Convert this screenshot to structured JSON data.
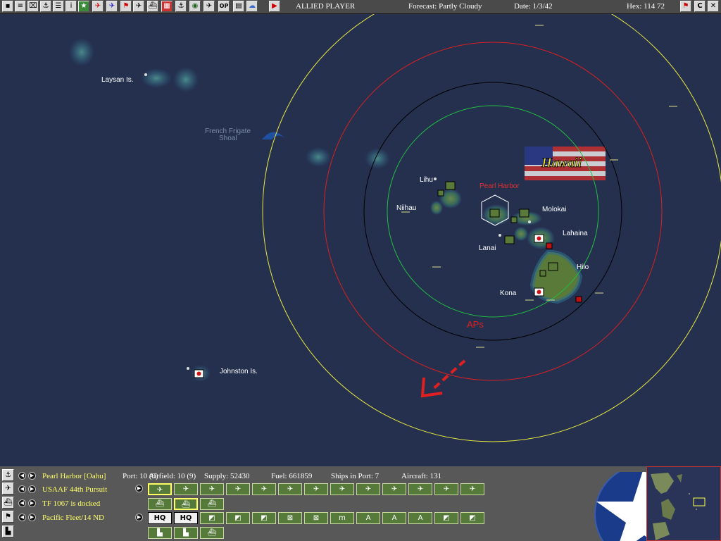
{
  "topbar": {
    "tool_icons": [
      "save-icon",
      "document-icon",
      "report-icon",
      "ship-icon",
      "info-icon",
      "star-icon",
      "aircraft-red-icon",
      "aircraft-blue-icon",
      "flag-icon",
      "plane-icon",
      "ship-list-icon",
      "map-icon",
      "convoy-icon",
      "globe-icon",
      "op-icon",
      "grid-icon",
      "cloud-icon"
    ],
    "op_label": "OP",
    "info_label": "i",
    "play_icon": "play-icon",
    "player": "ALLIED PLAYER",
    "forecast": "Forecast: Partly Cloudy",
    "date": "Date: 1/3/42",
    "hex": "Hex: 114  72",
    "right_icons": [
      "flag-icon",
      "c-icon",
      "close-icon"
    ],
    "c_label": "C"
  },
  "map": {
    "labels": {
      "laysan": "Laysan Is.",
      "french_frigate": "French Frigate",
      "shoal": "Shoal",
      "hawaii": "Hawaii",
      "pearl_harbor": "Pearl Harbor",
      "lihu": "Lihu",
      "niihau": "Niihau",
      "molokai": "Molokai",
      "lahaina": "Lahaina",
      "lanai": "Lanai",
      "hilo": "Hilo",
      "kona": "Kona",
      "aps": "APs",
      "johnston": "Johnston Is."
    },
    "colors": {
      "ocean": "#25304f",
      "yellow_ring": "#e8e840",
      "red_ring": "#d82020",
      "black_ring": "#000000",
      "green_ring": "#20c040"
    }
  },
  "panel": {
    "row_icons": [
      "anchor-icon",
      "aircraft-icon",
      "ship-icon",
      "flag-icon",
      "factory-icon"
    ],
    "base_name": "Pearl Harbor [Oahu]",
    "port": "Port: 10 (9)",
    "airfield": "Airfield: 10 (9)",
    "supply": "Supply: 52430",
    "fuel": "Fuel: 661859",
    "ships_in_port": "Ships in Port: 7",
    "aircraft": "Aircraft: 131",
    "air_unit": "USAAF 44th Pursuit",
    "task_force": "TF 1067 is docked",
    "command": "Pacific Fleet/14 ND",
    "hq_label": "HQ",
    "hq2_label": "HQ",
    "m_label": "m",
    "a_label": "A"
  }
}
